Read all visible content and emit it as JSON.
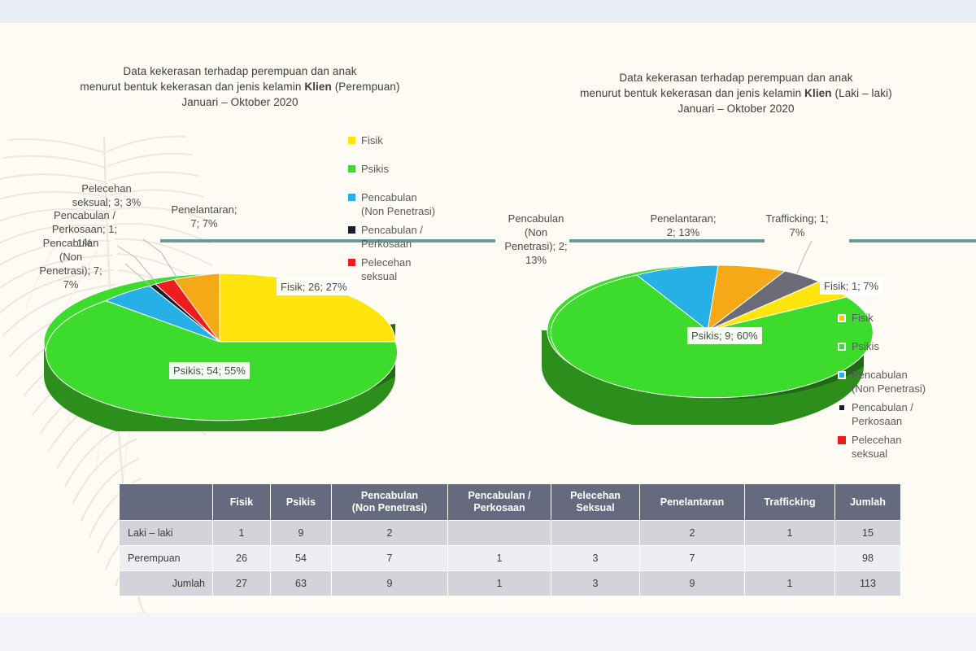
{
  "chart_data": [
    {
      "type": "pie",
      "title": "Data kekerasan terhadap perempuan dan  anak\nmenurut bentuk kekerasan dan jenis kelamin Klien (Perempuan)\nJanuari – Oktober 2020",
      "title_line1": "Data kekerasan terhadap perempuan dan  anak",
      "title_line2_a": "menurut bentuk kekerasan dan jenis kelamin ",
      "title_line2_b": "Klien",
      "title_line2_c": " (Perempuan)",
      "title_line3": "Januari – Oktober 2020",
      "categories": [
        "Fisik",
        "Psikis",
        "Pencabulan (Non Penetrasi)",
        "Pencabulan / Perkosaan",
        "Pelecehan seksual",
        "Penelantaran"
      ],
      "values": [
        26,
        54,
        7,
        1,
        3,
        7
      ],
      "percents": [
        "27%",
        "55%",
        "7%",
        "1%",
        "3%",
        "7%"
      ],
      "colors": [
        "#ffe40d",
        "#3ddb2b",
        "#27b0e6",
        "#1b1b2b",
        "#ee1c1c",
        "#f5a916"
      ],
      "labels": [
        "Fisik; 26; 27%",
        "Psikis; 54; 55%",
        "Pencabulan\n(Non\nPenetrasi); 7;\n7%",
        "Pencabulan /\nPerkosaan; 1;\n1%",
        "Pelecehan\nseksual; 3; 3%",
        "Penelantaran;\n7; 7%"
      ],
      "legend_position": "top-center-right"
    },
    {
      "type": "pie",
      "title": "Data kekerasan terhadap perempuan dan  anak\nmenurut bentuk kekerasan dan jenis kelamin Klien (Laki – laki)\nJanuari – Oktober 2020",
      "title_line1": "Data kekerasan terhadap perempuan dan  anak",
      "title_line2_a": "menurut bentuk kekerasan dan jenis kelamin ",
      "title_line2_b": "Klien",
      "title_line2_c": " (Laki – laki)",
      "title_line3": "Januari – Oktober 2020",
      "categories": [
        "Fisik",
        "Psikis",
        "Pencabulan (Non Penetrasi)",
        "Penelantaran",
        "Trafficking"
      ],
      "values": [
        1,
        9,
        2,
        2,
        1
      ],
      "percents": [
        "7%",
        "60%",
        "13%",
        "13%",
        "7%"
      ],
      "colors": [
        "#ffe40d",
        "#3ddb2b",
        "#27b0e6",
        "#f5a916",
        "#6b6b78"
      ],
      "labels": [
        "Fisik; 1; 7%",
        "Psikis; 9; 60%",
        "Pencabulan\n(Non\nPenetrasi); 2;\n13%",
        "Penelantaran;\n2; 13%",
        "Trafficking; 1;\n7%"
      ],
      "legend_position": "right"
    }
  ],
  "left_chart": {
    "legend": [
      {
        "label": "Fisik",
        "color": "#ffe40d"
      },
      {
        "label": "Psikis",
        "color": "#3ddb2b"
      },
      {
        "label": "Pencabulan\n(Non Penetrasi)",
        "color": "#27b0e6"
      },
      {
        "label": "Pencabulan /\nPerkosaan",
        "color": "#1b1b2b"
      },
      {
        "label": "Pelecehan\nseksual",
        "color": "#ee1c1c"
      }
    ]
  },
  "right_chart": {
    "legend": [
      {
        "label": "Fisik",
        "color": "#ffc20e"
      },
      {
        "label": "Psikis",
        "color": "#3ddb2b"
      },
      {
        "label": "Pencabulan\n(Non Penetrasi)",
        "color": "#27b0e6"
      },
      {
        "label": "Pencabulan /\nPerkosaan",
        "color": "#1b1b2b"
      },
      {
        "label": "Pelecehan\nseksual",
        "color": "#ee1c1c"
      }
    ]
  },
  "table": {
    "corner": "",
    "columns": [
      "Fisik",
      "Psikis",
      "Pencabulan\n(Non Penetrasi)",
      "Pencabulan /\nPerkosaan",
      "Pelecehan\nSeksual",
      "Penelantaran",
      "Trafficking",
      "Jumlah"
    ],
    "rows": [
      {
        "head": "Laki – laki",
        "cells": [
          "1",
          "9",
          "2",
          "",
          "",
          "2",
          "1",
          "15"
        ]
      },
      {
        "head": "Perempuan",
        "cells": [
          "26",
          "54",
          "7",
          "1",
          "3",
          "7",
          "",
          "98"
        ]
      },
      {
        "head": "Jumlah",
        "cells": [
          "27",
          "63",
          "9",
          "1",
          "3",
          "9",
          "1",
          "113"
        ]
      }
    ]
  },
  "colors": {
    "header_bg": "#666a7e",
    "row_bg": "#d2d4d9",
    "row_alt_bg": "#eceef1",
    "teal_line": "#4d8c8c",
    "slide_bg": "#fdfbf3"
  }
}
